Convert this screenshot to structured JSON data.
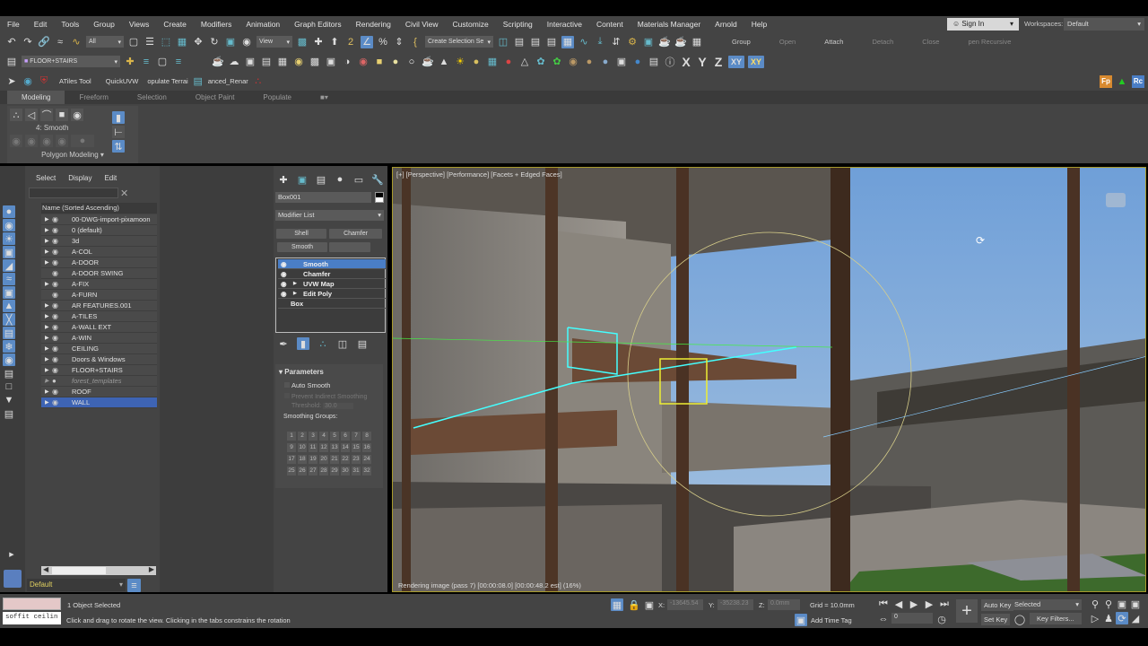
{
  "menu": [
    "File",
    "Edit",
    "Tools",
    "Group",
    "Views",
    "Create",
    "Modifiers",
    "Animation",
    "Graph Editors",
    "Rendering",
    "Civil View",
    "Customize",
    "Scripting",
    "Interactive",
    "Content",
    "Materials Manager",
    "Arnold",
    "Help"
  ],
  "account": {
    "sign_in": "Sign In",
    "workspaces_label": "Workspaces:",
    "workspace": "Default"
  },
  "toolbar1": {
    "filter": "All",
    "ref_coord": "View",
    "selection_set": "Create Selection Se",
    "group_buttons": [
      "Group",
      "Open",
      "Attach",
      "Detach",
      "Close",
      "pen Recursive"
    ]
  },
  "toolbar2": {
    "layer": "FLOOR+STAIRS",
    "axis": [
      "X",
      "Y",
      "Z",
      "XY",
      "XY"
    ]
  },
  "toolbar3": {
    "scripts": [
      "ATiles Tool",
      "QuickUVW",
      "opulate Terrai",
      "anced_Renar"
    ],
    "right_icons": [
      "Fp",
      "Rc"
    ]
  },
  "ribbon": {
    "tabs": [
      "Modeling",
      "Freeform",
      "Selection",
      "Object Paint",
      "Populate"
    ],
    "subobject_label": "4: Smooth",
    "panel_title": "Polygon Modeling"
  },
  "explorer": {
    "tabs": [
      "Select",
      "Display",
      "Edit"
    ],
    "search_placeholder": "",
    "column": "Name (Sorted Ascending)",
    "layers": [
      "00-DWG-import-pixamoon",
      "0 (default)",
      "3d",
      "A-COL",
      "A-DOOR",
      "A-DOOR SWING",
      "A-FIX",
      "A-FURN",
      "AR FEATURES.001",
      "A-TILES",
      "A-WALL EXT",
      "A-WIN",
      "CEILING",
      "Doors & Windows",
      "FLOOR+STAIRS",
      "forest_templates",
      "ROOF",
      "WALL"
    ],
    "selected": "WALL",
    "layer_dropdown": "Default"
  },
  "command_panel": {
    "object_name": "Box001",
    "modifier_list": "Modifier List",
    "mod_buttons": [
      "Shell",
      "Chamfer",
      "Smooth"
    ],
    "stack": [
      "Smooth",
      "Chamfer",
      "UVW Map",
      "Edit Poly",
      "Box"
    ],
    "rollout": "Parameters",
    "auto_smooth": "Auto Smooth",
    "prevent": "Prevent Indirect Smoothing",
    "threshold_label": "Threshold:",
    "threshold": "30.0",
    "groups_label": "Smoothing Groups:"
  },
  "viewport": {
    "label": "[+] [Perspective] [Performance] [Facets + Edged Faces]",
    "render_status": "Rendering image (pass 7) [00:00:08.0] [00:00:48.2 est]",
    "render_suffix": "(16%)"
  },
  "status": {
    "swatch_text": "soffit ceilin",
    "selected": "1 Object Selected",
    "prompt": "Click and drag to rotate the view.  Clicking in the tabs constrains the rotation",
    "x_label": "X:",
    "x": "-13645.54",
    "y_label": "Y:",
    "y": "-35238.23",
    "z_label": "Z:",
    "z": "0.0mm",
    "grid": "Grid = 10.0mm",
    "add_time_tag": "Add Time Tag",
    "frame": "0",
    "auto_key": "Auto Key",
    "set_key": "Set Key",
    "key_mode": "Selected",
    "key_filters": "Key Filters..."
  }
}
